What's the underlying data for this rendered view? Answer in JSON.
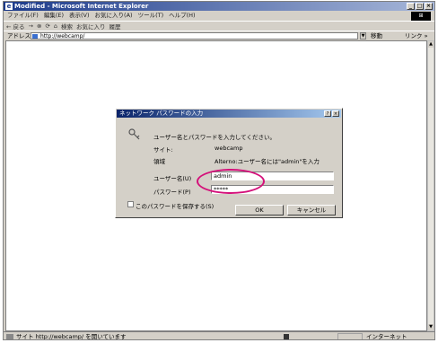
{
  "window": {
    "title": "Modified - Microsoft Internet Explorer",
    "app_icon": "ie-icon",
    "controls": [
      "_",
      "□",
      "×"
    ]
  },
  "menubar": [
    "ファイル(F)",
    "編集(E)",
    "表示(V)",
    "お気に入り(A)",
    "ツール(T)",
    "ヘルプ(H)"
  ],
  "toolbar": {
    "back": "← 戻る",
    "forward": "→",
    "stop": "⊗",
    "refresh": "⟳",
    "home": "⌂",
    "search": "検索",
    "favorites": "お気に入り",
    "history": "履歴"
  },
  "addressbar": {
    "label": "アドレス(D)",
    "url": "http://webcamp/",
    "go": "移動",
    "links": "リンク »"
  },
  "dialog": {
    "title": "ネットワーク パスワードの入力",
    "help": "?",
    "close": "×",
    "prompt": "ユーザー名とパスワードを入力してください。",
    "site_label": "サイト:",
    "site_value": "webcamp",
    "realm_label": "領域",
    "realm_value": "Alterno:ユーザー名には\"admin\"を入力",
    "username_label": "ユーザー名(U)",
    "username_value": "admin",
    "password_label": "パスワード(P)",
    "password_value": "*****",
    "remember_label": "このパスワードを保存する(S)",
    "remember_checked": false,
    "ok_label": "OK",
    "cancel_label": "キャンセル"
  },
  "highlight": {
    "color": "#d4107a"
  },
  "statusbar": {
    "message": "サイト http://webcamp/ を開いています",
    "zone": "インターネット"
  }
}
